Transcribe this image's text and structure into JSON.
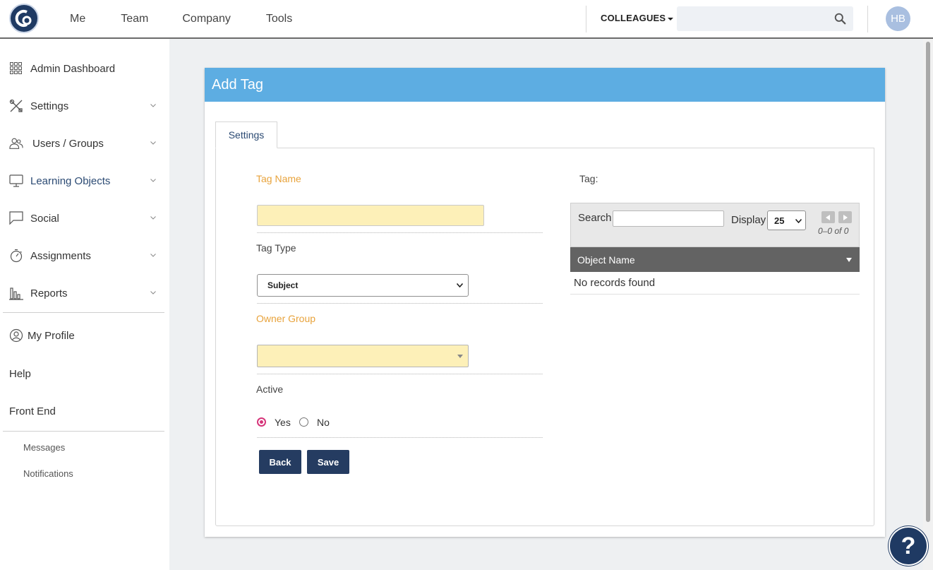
{
  "topnav": {
    "items": [
      "Me",
      "Team",
      "Company",
      "Tools"
    ],
    "colleagues_label": "COLLEAGUES",
    "search_placeholder": "",
    "avatar_initials": "HB"
  },
  "sidebar": {
    "items": [
      {
        "label": "Admin Dashboard",
        "icon": "grid-icon"
      },
      {
        "label": "Settings",
        "icon": "tools-icon"
      },
      {
        "label": "Users / Groups",
        "icon": "users-icon"
      },
      {
        "label": "Learning Objects",
        "icon": "monitor-icon"
      },
      {
        "label": "Social",
        "icon": "chat-icon"
      },
      {
        "label": "Assignments",
        "icon": "stopwatch-icon"
      },
      {
        "label": "Reports",
        "icon": "bar-chart-icon"
      }
    ],
    "my_profile": "My Profile",
    "help": "Help",
    "front_end": "Front End",
    "messages": "Messages",
    "notifications": "Notifications"
  },
  "card": {
    "title": "Add Tag",
    "tab": "Settings",
    "form": {
      "tag_name_label": "Tag Name",
      "tag_name_value": "",
      "tag_type_label": "Tag Type",
      "tag_type_value": "Subject",
      "owner_group_label": "Owner Group",
      "owner_group_value": "",
      "active_label": "Active",
      "active_yes": "Yes",
      "active_no": "No",
      "active_selected": "Yes",
      "back_button": "Back",
      "save_button": "Save"
    },
    "tag_grid": {
      "label": "Tag:",
      "search_label": "Search",
      "search_value": "",
      "display_label": "Display",
      "display_value": "25",
      "pagination": "0–0 of 0",
      "column": "Object Name",
      "empty_text": "No records found"
    }
  },
  "help_button": "?",
  "colors": {
    "header_blue": "#5dade2",
    "navy": "#253c61",
    "required_orange": "#e8a33c",
    "input_yellow": "#fdf0b8"
  }
}
